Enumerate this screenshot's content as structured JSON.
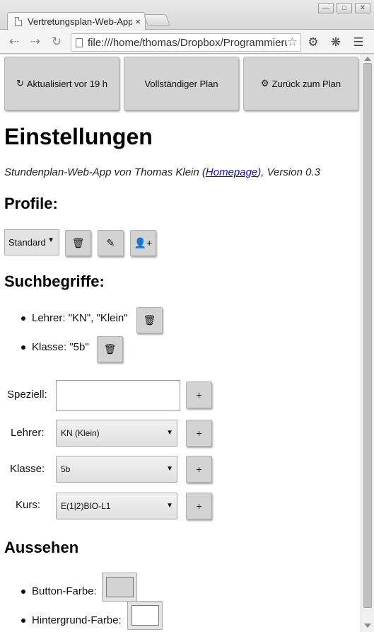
{
  "browser": {
    "tab_title": "Vertretungsplan-Web-App",
    "tab_close": "×",
    "url": "file:///home/thomas/Dropbox/Programmierung/",
    "window_controls": [
      "minimize-icon",
      "maximize-icon",
      "close-icon"
    ],
    "toolbar_icons": [
      "back-icon",
      "forward-icon",
      "reload-icon",
      "page-icon",
      "star-icon",
      "gear-icon",
      "bug-icon",
      "menu-icon"
    ]
  },
  "topnav": {
    "updated_label": "Aktualisiert vor 19 h",
    "full_plan_label": "Vollständiger Plan",
    "back_label": "Zurück zum Plan"
  },
  "page": {
    "title": "Einstellungen",
    "meta_prefix": "Stundenplan-Web-App von Thomas Klein (",
    "meta_link": "Homepage",
    "meta_suffix": "), Version 0.3"
  },
  "profiles": {
    "heading": "Profile:",
    "selected": "Standard",
    "actions": [
      "trash-icon",
      "pencil-icon",
      "add-user-icon"
    ]
  },
  "search_terms": {
    "heading": "Suchbegriffe:",
    "items": [
      {
        "text": "Lehrer: \"KN\", \"Klein\""
      },
      {
        "text": "Klasse: \"5b\""
      }
    ]
  },
  "filters": {
    "special_label": "Speziell:",
    "special_value": "",
    "teacher_label": "Lehrer:",
    "teacher_value": "KN (Klein)",
    "class_label": "Klasse:",
    "class_value": "5b",
    "course_label": "Kurs:",
    "course_value": "E(1|2)BIO-L1",
    "add_label": "+"
  },
  "appearance": {
    "heading": "Aussehen",
    "button_color_label": "Button-Farbe:",
    "button_color": "#d3d3d3",
    "background_color_label": "Hintergrund-Farbe:",
    "background_color": "#ffffff"
  }
}
